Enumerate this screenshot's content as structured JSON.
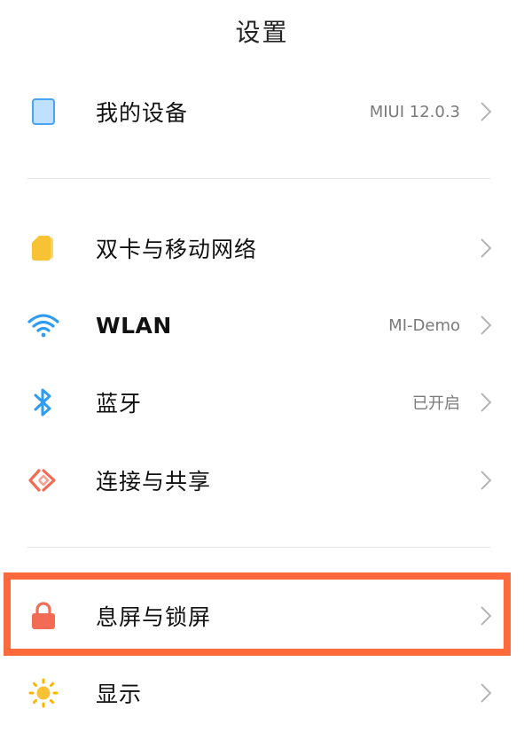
{
  "header": {
    "title": "设置"
  },
  "rows": [
    {
      "key": "my_device",
      "label": "我的设备",
      "value": "MIUI 12.0.3",
      "icon": "tablet-icon",
      "color": "#4aa3f5"
    },
    {
      "key": "sim",
      "label": "双卡与移动网络",
      "value": "",
      "icon": "sim-card-icon",
      "color": "#f7c233"
    },
    {
      "key": "wlan",
      "label": "WLAN",
      "value": "MI-Demo",
      "icon": "wifi-icon",
      "color": "#2f9cf3"
    },
    {
      "key": "bluetooth",
      "label": "蓝牙",
      "value": "已开启",
      "icon": "bluetooth-icon",
      "color": "#2f9cf3"
    },
    {
      "key": "connection",
      "label": "连接与共享",
      "value": "",
      "icon": "share-connection-icon",
      "color": "#f26b55"
    },
    {
      "key": "lockscreen",
      "label": "息屏与锁屏",
      "value": "",
      "icon": "lock-icon",
      "color": "#f26b55"
    },
    {
      "key": "display",
      "label": "显示",
      "value": "",
      "icon": "sun-icon",
      "color": "#f7b500"
    }
  ],
  "highlight": {
    "color": "#ff6a3d",
    "target": "lockscreen"
  }
}
